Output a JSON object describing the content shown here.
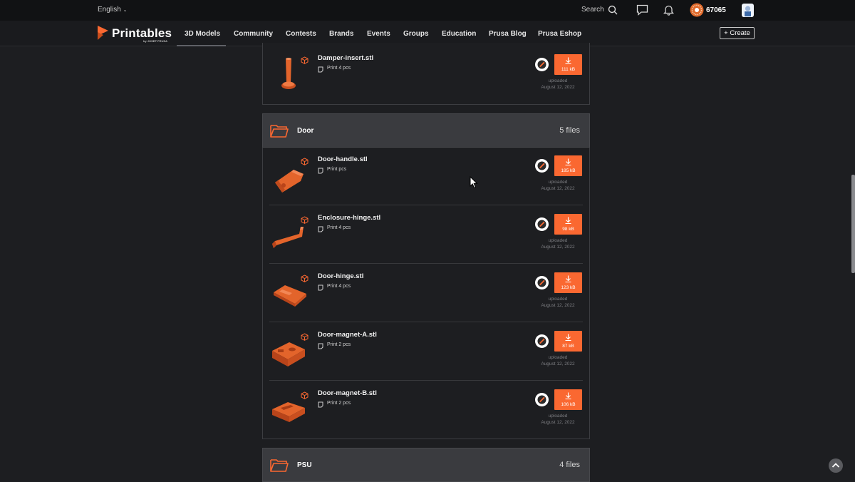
{
  "topbar": {
    "language": "English",
    "search_label": "Search",
    "points": "67065"
  },
  "nav": {
    "logo": "Printables",
    "logo_sub": "by JOSEF PRUSA",
    "items": [
      "3D Models",
      "Community",
      "Contests",
      "Brands",
      "Events",
      "Groups",
      "Education",
      "Prusa Blog",
      "Prusa Eshop"
    ],
    "active": "3D Models",
    "create_label": "+ Create"
  },
  "prev_file": {
    "name": "Damper-insert.stl",
    "print": "Print 4 pcs",
    "size": "111 kB",
    "uploaded_label": "uploaded",
    "uploaded_date": "August 12, 2022"
  },
  "groups": [
    {
      "name": "Door",
      "count": "5 files",
      "files": [
        {
          "name": "Door-handle.stl",
          "print": "Print pcs",
          "size": "185 kB",
          "uploaded_label": "uploaded",
          "uploaded_date": "August 12, 2022"
        },
        {
          "name": "Enclosure-hinge.stl",
          "print": "Print 4 pcs",
          "size": "98 kB",
          "uploaded_label": "uploaded",
          "uploaded_date": "August 12, 2022"
        },
        {
          "name": "Door-hinge.stl",
          "print": "Print 4 pcs",
          "size": "123 kB",
          "uploaded_label": "uploaded",
          "uploaded_date": "August 12, 2022"
        },
        {
          "name": "Door-magnet-A.stl",
          "print": "Print 2 pcs",
          "size": "87 kB",
          "uploaded_label": "uploaded",
          "uploaded_date": "August 12, 2022"
        },
        {
          "name": "Door-magnet-B.stl",
          "print": "Print 2 pcs",
          "size": "106 kB",
          "uploaded_label": "uploaded",
          "uploaded_date": "August 12, 2022"
        }
      ]
    },
    {
      "name": "PSU",
      "count": "4 files"
    }
  ],
  "colors": {
    "accent": "#fa6831",
    "background": "#1d1e21",
    "group_header": "#3a3b3f"
  }
}
